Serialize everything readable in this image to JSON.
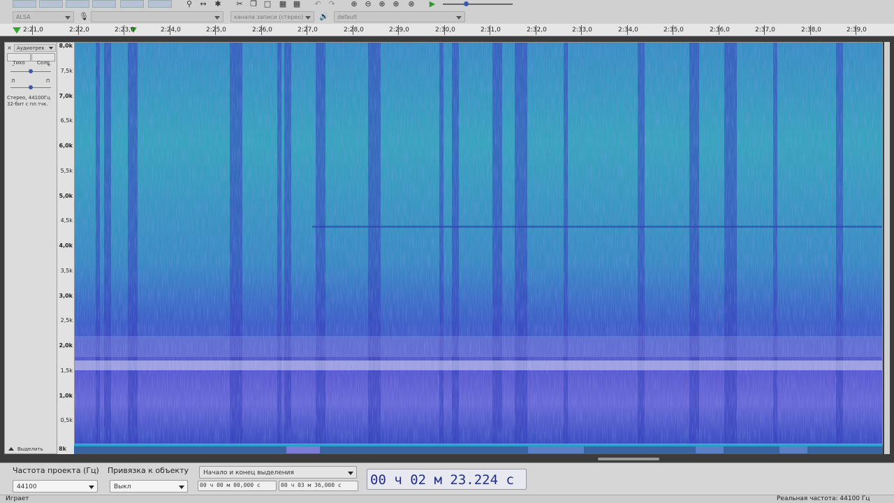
{
  "toolbar": {
    "host": "ALSA",
    "recording_channels": "канала записи (стерео)",
    "output_device": "default"
  },
  "timeline": {
    "ticks": [
      "2:21,0",
      "2:22,0",
      "2:23,0",
      "2:24,0",
      "2:25,0",
      "2:26,0",
      "2:27,0",
      "2:28,0",
      "2:29,0",
      "2:30,0",
      "2:31,0",
      "2:32,0",
      "2:33,0",
      "2:34,0",
      "2:35,0",
      "2:36,0",
      "2:37,0",
      "2:38,0",
      "2:39,0"
    ]
  },
  "track": {
    "name": "Аудиотрек",
    "mute_label": "Тихо",
    "solo_label": "Соло",
    "pan_left": "Л",
    "pan_right": "П",
    "info_line1": "Стерео, 44100Гц",
    "info_line2": "32-бит с пл.тчк.",
    "select_label": "Выделить"
  },
  "freq_axis": {
    "labels": [
      "8,0k",
      "7,5k",
      "7,0k",
      "6,5k",
      "6,0k",
      "5,5k",
      "5,0k",
      "4,5k",
      "4,0k",
      "3,5k",
      "3,0k",
      "2,5k",
      "2,0k",
      "1,5k",
      "1,0k",
      "0,5k",
      "8k"
    ]
  },
  "bottom": {
    "rate_label": "Частота проекта (Гц)",
    "rate_value": "44100",
    "snap_label": "Привязка к объекту",
    "snap_value": "Выкл",
    "selection_mode": "Начало и конец выделения",
    "sel_start": "00 ч 00 м 00,000 с",
    "sel_end": "00 ч 03 м 36,000 с",
    "position": "00 ч 02 м 23.224 с"
  },
  "status": {
    "left": "Играет",
    "right": "Реальная частота: 44100 Гц"
  },
  "colors": {
    "spectrogram_base": "#3f55c8",
    "spectrogram_high": "#3aa0c0",
    "spectrogram_peak": "#d8d8f0",
    "selection_green": "#34a834"
  }
}
